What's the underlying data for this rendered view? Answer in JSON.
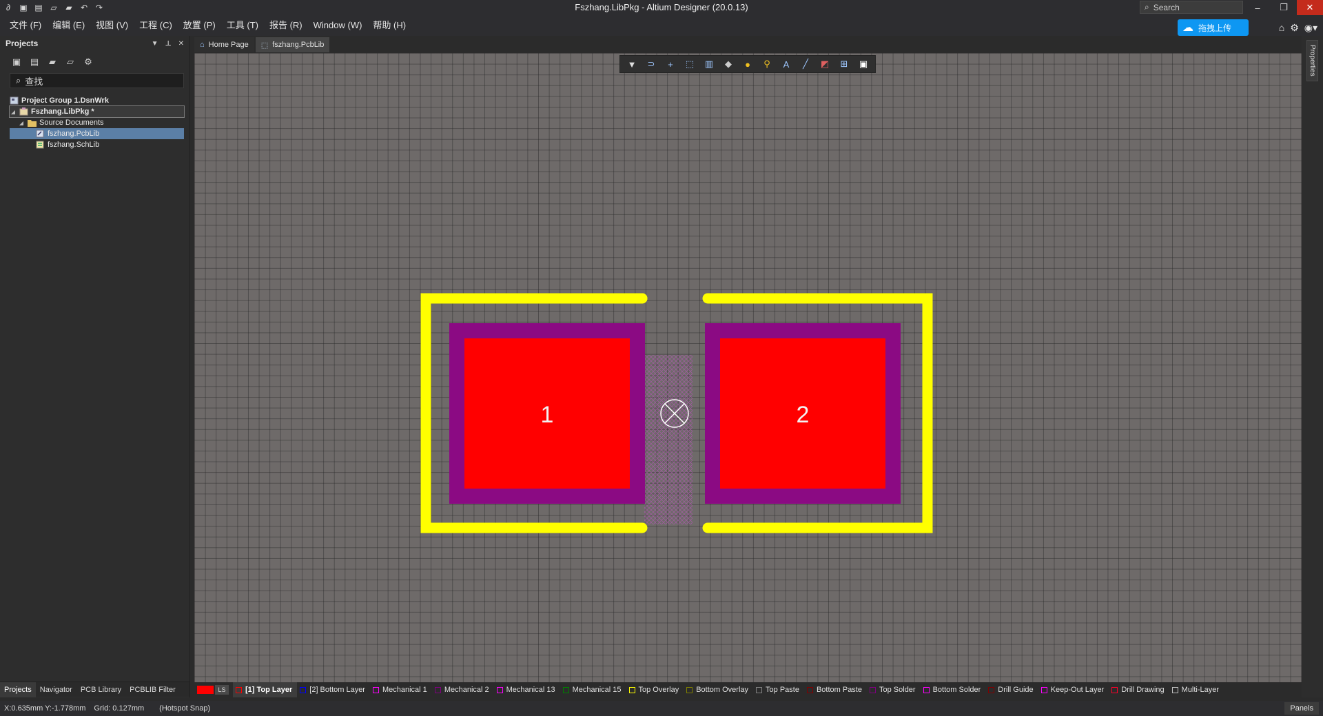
{
  "window": {
    "title": "Fszhang.LibPkg - Altium Designer (20.0.13)",
    "search_placeholder": "Search"
  },
  "menu": [
    "文件 (F)",
    "编辑 (E)",
    "视图 (V)",
    "工程 (C)",
    "放置 (P)",
    "工具 (T)",
    "报告 (R)",
    "Window (W)",
    "帮助 (H)"
  ],
  "upload_button": "拖拽上传",
  "projects_panel": {
    "title": "Projects",
    "search_placeholder": "查找",
    "tree": {
      "group": "Project Group 1.DsnWrk",
      "project": "Fszhang.LibPkg *",
      "folder": "Source Documents",
      "files": [
        "fszhang.PcbLib",
        "fszhang.SchLib"
      ]
    },
    "bottom_tabs": [
      "Projects",
      "Navigator",
      "PCB Library",
      "PCBLIB Filter"
    ]
  },
  "doc_tabs": [
    "Home Page",
    "fszhang.PcbLib"
  ],
  "right_tab": "Properties",
  "pcb": {
    "pad1_label": "1",
    "pad2_label": "2"
  },
  "layers": {
    "ls_label": "LS",
    "items": [
      {
        "name": "[1] Top Layer",
        "color": "#ff0000",
        "active": true
      },
      {
        "name": "[2] Bottom Layer",
        "color": "#0000ff"
      },
      {
        "name": "Mechanical 1",
        "color": "#ff00ff"
      },
      {
        "name": "Mechanical 2",
        "color": "#800080"
      },
      {
        "name": "Mechanical 13",
        "color": "#ff00ff"
      },
      {
        "name": "Mechanical 15",
        "color": "#008000"
      },
      {
        "name": "Top Overlay",
        "color": "#ffff00"
      },
      {
        "name": "Bottom Overlay",
        "color": "#808000"
      },
      {
        "name": "Top Paste",
        "color": "#808080"
      },
      {
        "name": "Bottom Paste",
        "color": "#800000"
      },
      {
        "name": "Top Solder",
        "color": "#800080"
      },
      {
        "name": "Bottom Solder",
        "color": "#ff00ff"
      },
      {
        "name": "Drill Guide",
        "color": "#800000"
      },
      {
        "name": "Keep-Out Layer",
        "color": "#ff00ff"
      },
      {
        "name": "Drill Drawing",
        "color": "#ff002a"
      },
      {
        "name": "Multi-Layer",
        "color": "#c0c0c0"
      }
    ]
  },
  "status": {
    "coords": "X:0.635mm Y:-1.778mm",
    "grid": "Grid: 0.127mm",
    "snap": "(Hotspot Snap)",
    "panels": "Panels"
  }
}
